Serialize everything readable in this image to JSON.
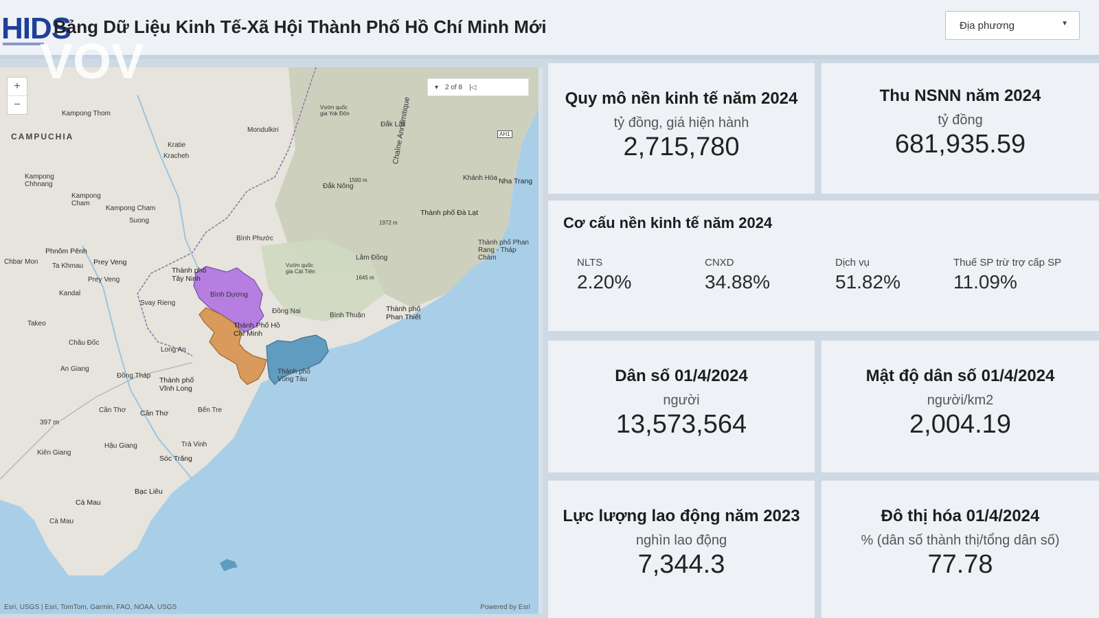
{
  "header": {
    "logo": "HIDS",
    "title": "Bảng Dữ Liệu Kinh Tế-Xã Hội Thành Phố Hồ Chí Minh Mới",
    "watermark": "VOV",
    "dropdown_value": "Địa phương"
  },
  "map": {
    "pager": "2 of 8",
    "labels": {
      "campuchia": "CAMPUCHIA",
      "kampong_thom": "Kampong Thom",
      "mondulkiri": "Mondulkiri",
      "kratie": "Kratie",
      "kracheh": "Kracheh",
      "kampong_chhnang": "Kampong Chhnang",
      "kampong_cham_1": "Kampong Cham",
      "kampong_cham_2": "Kampong Cham",
      "suong": "Suong",
      "phnom_penh": "Phnôm Pênh",
      "chbar_mon": "Chbar Mon",
      "ta_khmau": "Ta Khmau",
      "prey_veng_1": "Prey Veng",
      "prey_veng_2": "Prey Veng",
      "kandal": "Kandal",
      "svay_rieng": "Svay Rieng",
      "takeo": "Takeo",
      "chau_doc": "Châu Đốc",
      "an_giang": "An Giang",
      "dong_thap": "Đồng Tháp",
      "long_an": "Long An",
      "can_tho_1": "Cần Thơ",
      "can_tho_2": "Cần Thơ",
      "vinh_long": "Thành phố Vĩnh Long",
      "ben_tre": "Bến Tre",
      "tra_vinh": "Trà Vinh",
      "hau_giang": "Hậu Giang",
      "kien_giang": "Kiên Giang",
      "soc_trang": "Sóc Trăng",
      "bac_lieu": "Bạc Liêu",
      "ca_mau_1": "Cà Mau",
      "ca_mau_2": "Cà Mau",
      "binh_phuoc": "Bình Phước",
      "tay_ninh": "Thành phố Tây Ninh",
      "binh_duong": "Bình Dương",
      "hcm": "Thành Phố Hồ Chí Minh",
      "vung_tau": "Thành phố Vũng Tàu",
      "dong_nai": "Đồng Nai",
      "binh_thuan": "Bình Thuận",
      "phan_thiet": "Thành phố Phan Thiết",
      "lam_dong": "Lâm Đồng",
      "da_lat": "Thành phố Đà Lạt",
      "phan_rang": "Thành phố Phan Rang - Tháp Chàm",
      "nha_trang": "Nha Trang",
      "khanh_hoa": "Khánh Hòa",
      "dak_nong": "Đắk Nông",
      "dak_lak": "Đắk Lắk",
      "yok_don": "Vườn quốc gia Yok Đôn",
      "cat_tien": "Vườn quốc gia Cát Tiên",
      "chaine": "Chaîne Annamitique",
      "ah1": "AH1",
      "elev_1590": "1590 m",
      "elev_1972": "1972 m",
      "elev_1645": "1645 m",
      "elev_397": "397 m"
    },
    "credit_left": "Esri, USGS | Esri, TomTom, Garmin, FAO, NOAA, USGS",
    "credit_right": "Powered by Esri"
  },
  "cards": {
    "gdp": {
      "title": "Quy mô nền kinh tế năm 2024",
      "unit": "tỷ đồng, giá hiện hành",
      "value": "2,715,780"
    },
    "budget": {
      "title": "Thu NSNN năm 2024",
      "unit": "tỷ đồng",
      "value": "681,935.59"
    },
    "population": {
      "title": "Dân số 01/4/2024",
      "unit": "người",
      "value": "13,573,564"
    },
    "density": {
      "title": "Mật độ dân số 01/4/2024",
      "unit": "người/km2",
      "value": "2,004.19"
    },
    "labor": {
      "title": "Lực lượng lao động năm 2023",
      "unit": "nghìn lao động",
      "value": "7,344.3"
    },
    "urban": {
      "title": "Đô thị hóa 01/4/2024",
      "unit": "% (dân số thành thị/tổng dân số)",
      "value": "77.78"
    }
  },
  "structure": {
    "title": "Cơ cấu nền kinh tế năm 2024",
    "items": [
      {
        "label": "NLTS",
        "value": "2.20%"
      },
      {
        "label": "CNXD",
        "value": "34.88%"
      },
      {
        "label": "Dịch vụ",
        "value": "51.82%"
      },
      {
        "label": "Thuế SP trừ trợ cấp SP",
        "value": "11.09%"
      }
    ]
  },
  "colors": {
    "binh_duong": "#b57ee0",
    "hcm": "#d99a5b",
    "vung_tau": "#5f9cc0",
    "sea": "#a9cfe8",
    "land": "#e8e6df"
  }
}
